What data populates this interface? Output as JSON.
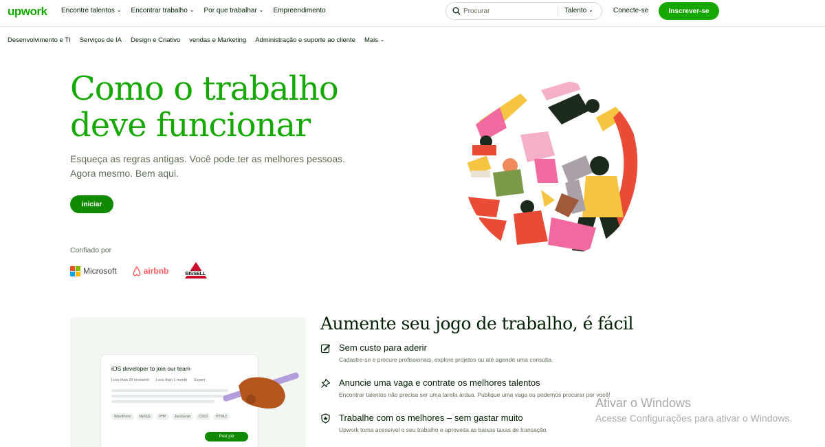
{
  "header": {
    "logo": "upwork",
    "nav": [
      {
        "label": "Encontre talentos",
        "dropdown": true
      },
      {
        "label": "Encontrar trabalho",
        "dropdown": true
      },
      {
        "label": "Por que trabalhar",
        "dropdown": true
      },
      {
        "label": "Empreendimento",
        "dropdown": false
      }
    ],
    "search": {
      "placeholder": "Procurar",
      "select": "Talento"
    },
    "login": "Conecte-se",
    "signup": "Inscrever-se"
  },
  "categories": [
    "Desenvolvimento e TI",
    "Serviços de IA",
    "Design e Criativo",
    "vendas e Marketing",
    "Administração e suporte ao cliente",
    "Mais"
  ],
  "hero": {
    "title_line1": "Como o trabalho",
    "title_line2": "deve funcionar",
    "subtitle_line1": "Esqueça as regras antigas. Você pode ter as melhores pessoas.",
    "subtitle_line2": "Agora mesmo. Bem aqui.",
    "cta": "iniciar",
    "trusted_label": "Confiado por",
    "logos": [
      "Microsoft",
      "airbnb",
      "BISSELL"
    ]
  },
  "job_preview": {
    "title": "iOS developer to join our team",
    "meta": [
      "Less than 20 hrs/week",
      "Less than 1 month",
      "Expert"
    ],
    "tags": [
      "WordPress",
      "MySQL",
      "PHP",
      "JavaScript",
      "CSS3",
      "HTML5"
    ],
    "button": "Post job"
  },
  "section": {
    "title": "Aumente seu jogo de trabalho, é fácil",
    "features": [
      {
        "icon": "edit-icon",
        "title": "Sem custo para aderir",
        "desc": "Cadastre-se e procure profissionais, explore projetos ou até agende uma consulta."
      },
      {
        "icon": "pin-icon",
        "title": "Anuncie uma vaga e contrate os melhores talentos",
        "desc": "Encontrar talentos não precisa ser uma tarefa árdua. Publique uma vaga ou podemos procurar por você!"
      },
      {
        "icon": "shield-star-icon",
        "title": "Trabalhe com os melhores – sem gastar muito",
        "desc": "Upwork torna acessível o seu trabalho e aproveita as baixas taxas de transação."
      }
    ]
  },
  "watermark": {
    "line1": "Ativar o Windows",
    "line2": "Acesse Configurações para ativar o Windows."
  },
  "colors": {
    "brand_green": "#14a800",
    "button_green": "#108a00",
    "text_dark": "#001e00",
    "text_muted": "#5e6d55"
  }
}
